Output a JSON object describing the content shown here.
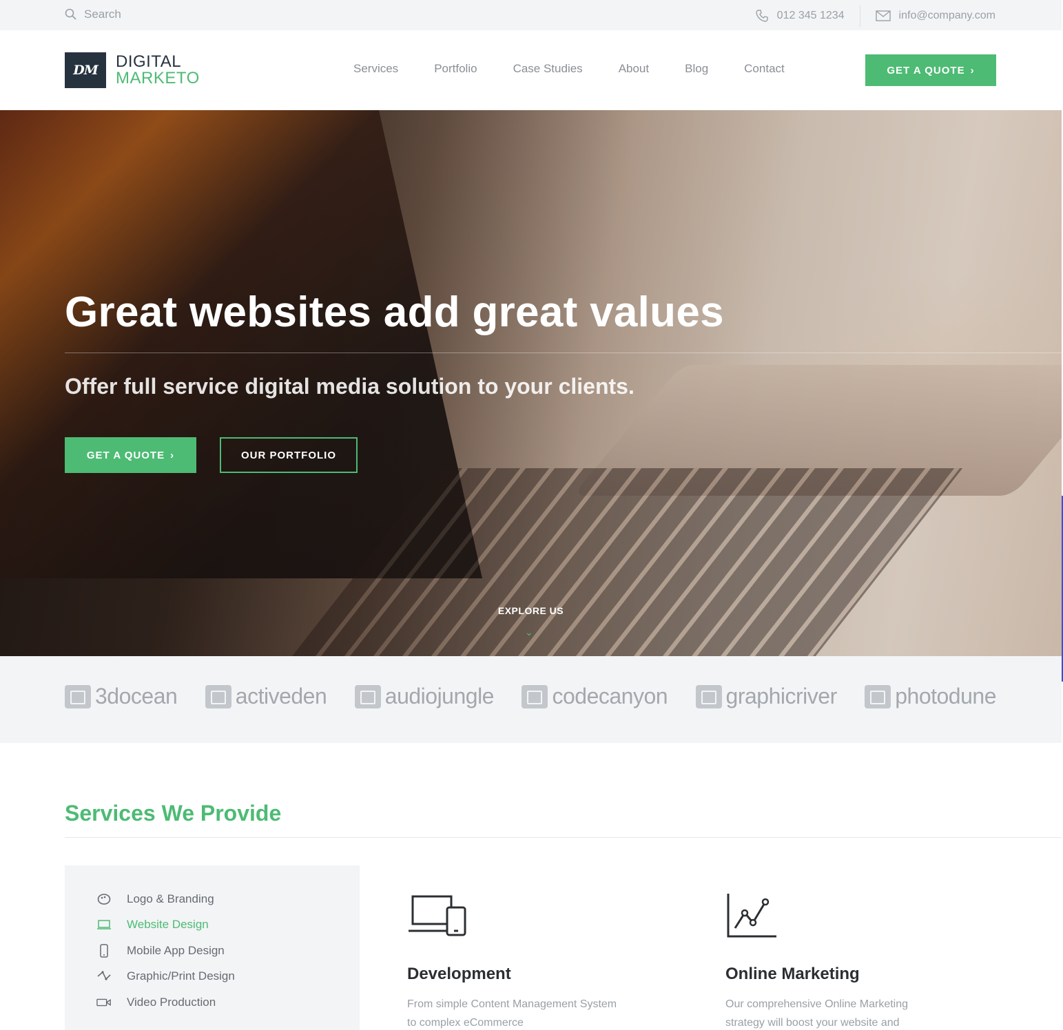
{
  "topbar": {
    "search_placeholder": "Search",
    "phone": "012 345 1234",
    "email": "info@company.com"
  },
  "header": {
    "logo_mark": "DM",
    "logo_line1": "DIGITAL",
    "logo_line2": "MARKETO",
    "nav": [
      "Services",
      "Portfolio",
      "Case Studies",
      "About",
      "Blog",
      "Contact"
    ],
    "cta": "GET A QUOTE"
  },
  "hero": {
    "title": "Great websites add great values",
    "subtitle": "Offer full service digital media solution to your clients.",
    "primary_button": "GET A QUOTE",
    "secondary_button": "OUR PORTFOLIO",
    "explore": "EXPLORE US"
  },
  "brands": [
    "3docean",
    "activeden",
    "audiojungle",
    "codecanyon",
    "graphicriver",
    "photodune"
  ],
  "services": {
    "title": "Services We Provide",
    "list": [
      {
        "label": "Logo & Branding",
        "icon": "palette-icon",
        "active": false
      },
      {
        "label": "Website Design",
        "icon": "laptop-icon",
        "active": true
      },
      {
        "label": "Mobile App Design",
        "icon": "mobile-icon",
        "active": false
      },
      {
        "label": "Graphic/Print Design",
        "icon": "vector-icon",
        "active": false
      },
      {
        "label": "Video Production",
        "icon": "video-camera-icon",
        "active": false
      }
    ],
    "features": [
      {
        "title": "Development",
        "text": "From simple Content Management System to complex eCommerce",
        "icon": "devices-icon"
      },
      {
        "title": "Online Marketing",
        "text": "Our comprehensive Online Marketing strategy will boost your website and",
        "icon": "line-chart-icon"
      }
    ]
  },
  "colors": {
    "accent": "#4dbb74",
    "dark": "#27323f",
    "topbar_bg": "#f3f4f6"
  }
}
